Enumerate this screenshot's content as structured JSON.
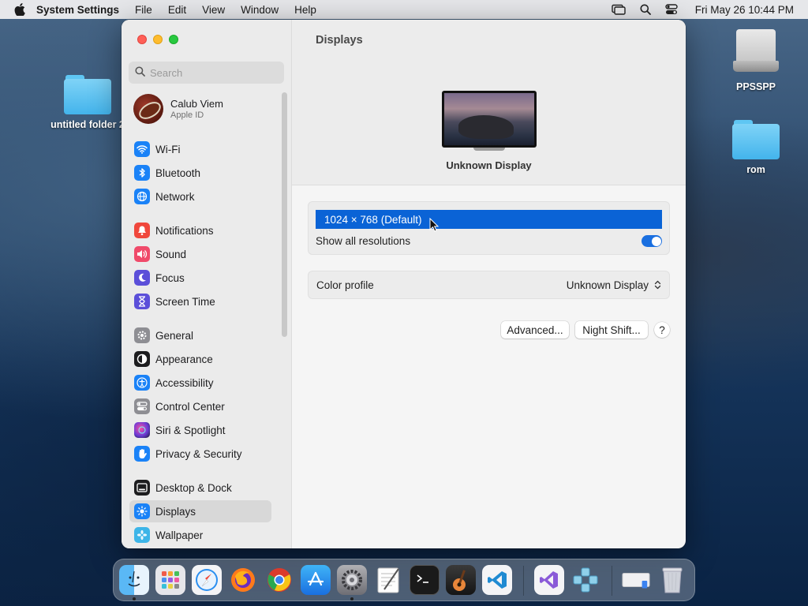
{
  "menubar": {
    "app_name": "System Settings",
    "menus": [
      "File",
      "Edit",
      "View",
      "Window",
      "Help"
    ],
    "clock": "Fri May 26  10:44 PM"
  },
  "desktop": {
    "icons": [
      {
        "label": "untitled folder 2",
        "kind": "folder"
      },
      {
        "label": "PPSSPP",
        "kind": "drive"
      },
      {
        "label": "rom",
        "kind": "folder"
      }
    ]
  },
  "sidebar": {
    "search_placeholder": "Search",
    "profile": {
      "name": "Calub Viem",
      "subtitle": "Apple ID"
    },
    "items": [
      {
        "label": "Wi-Fi",
        "icon": "wifi-icon",
        "color": "#1a82f7"
      },
      {
        "label": "Bluetooth",
        "icon": "bluetooth-icon",
        "color": "#1a82f7"
      },
      {
        "label": "Network",
        "icon": "globe-icon",
        "color": "#1a82f7"
      },
      {
        "label": "Notifications",
        "icon": "bell-icon",
        "color": "#f0473c"
      },
      {
        "label": "Sound",
        "icon": "speaker-icon",
        "color": "#f04a6a"
      },
      {
        "label": "Focus",
        "icon": "moon-icon",
        "color": "#5b4fd9"
      },
      {
        "label": "Screen Time",
        "icon": "hourglass-icon",
        "color": "#5b4fd9"
      },
      {
        "label": "General",
        "icon": "gear-icon",
        "color": "#8e8e93"
      },
      {
        "label": "Appearance",
        "icon": "appearance-icon",
        "color": "#1d1d1f"
      },
      {
        "label": "Accessibility",
        "icon": "accessibility-icon",
        "color": "#1a82f7"
      },
      {
        "label": "Control Center",
        "icon": "control-center-icon",
        "color": "#8e8e93"
      },
      {
        "label": "Siri & Spotlight",
        "icon": "siri-icon",
        "color": "#6a3bd6"
      },
      {
        "label": "Privacy & Security",
        "icon": "hand-icon",
        "color": "#1a82f7"
      },
      {
        "label": "Desktop & Dock",
        "icon": "dock-icon",
        "color": "#1d1d1f"
      },
      {
        "label": "Displays",
        "icon": "sun-icon",
        "color": "#1a82f7",
        "selected": true
      },
      {
        "label": "Wallpaper",
        "icon": "wallpaper-icon",
        "color": "#3db5e8"
      }
    ]
  },
  "content": {
    "title": "Displays",
    "display_name": "Unknown Display",
    "resolution_selected": "1024 × 768 (Default)",
    "show_all_label": "Show all resolutions",
    "show_all_enabled": true,
    "color_profile_label": "Color profile",
    "color_profile_value": "Unknown Display",
    "advanced_button": "Advanced...",
    "night_shift_button": "Night Shift...",
    "help_button": "?"
  },
  "dock": {
    "apps": [
      "Finder",
      "Launchpad",
      "Safari",
      "Firefox",
      "Chrome",
      "App Store",
      "System Settings",
      "TextEdit",
      "Terminal",
      "GarageBand",
      "Visual Studio Code",
      "Visual Studio",
      "PPSSPP",
      "Disk",
      "Trash"
    ]
  }
}
